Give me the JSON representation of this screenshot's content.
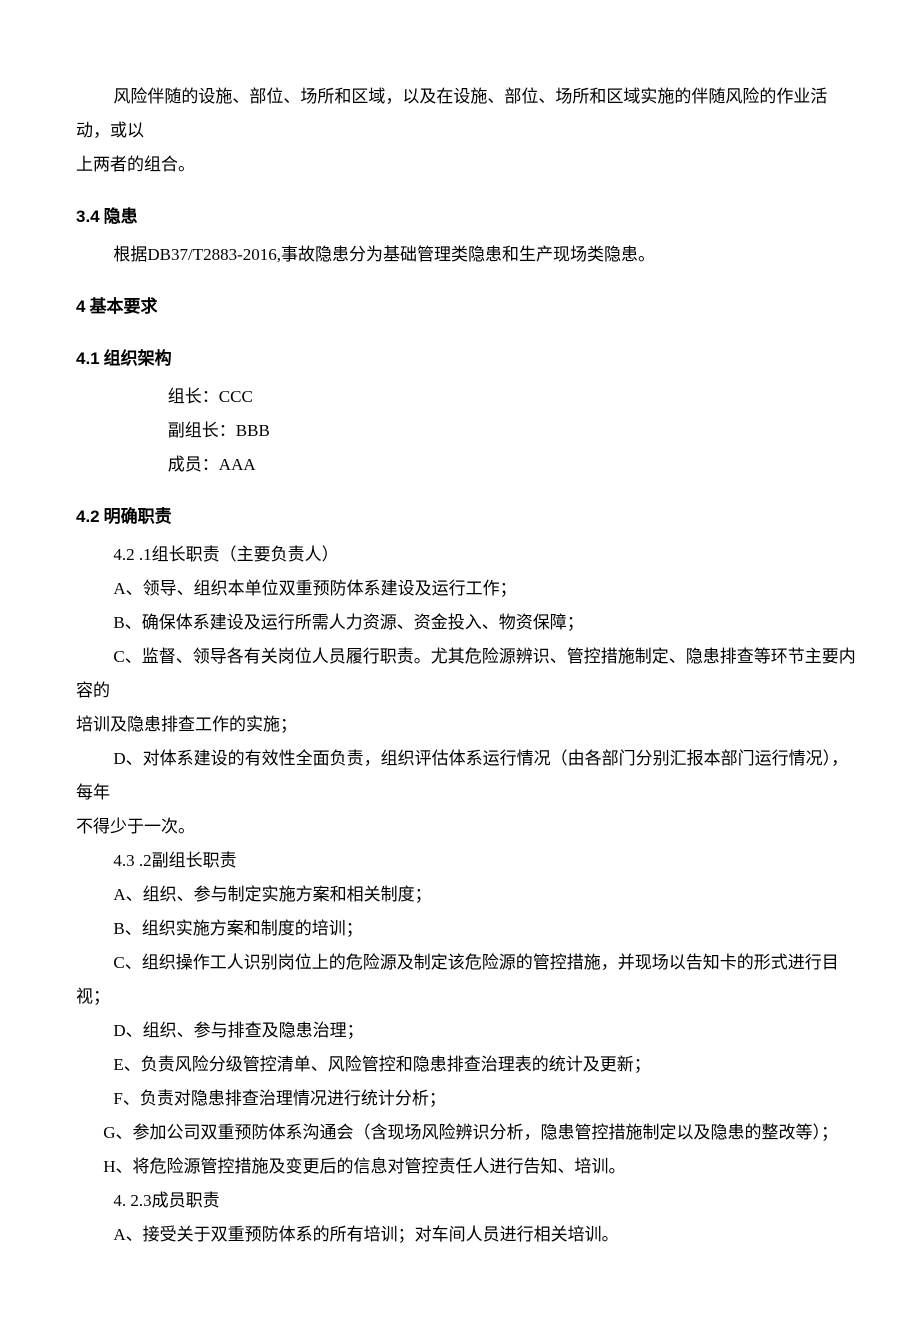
{
  "p1_a": "风险伴随的设施、部位、场所和区域，以及在设施、部位、场所和区域实施的伴随风险的作业活动，或以",
  "p1_b": "上两者的组合。",
  "h34_num": "3.4",
  "h34_txt": "隐患",
  "p2": "根据DB37/T2883-2016,事故隐患分为基础管理类隐患和生产现场类隐患。",
  "h4_num": "4",
  "h4_txt": "基本要求",
  "h41_num": "4.1",
  "h41_txt": "组织架构",
  "org1": "组长：CCC",
  "org2": "副组长：BBB",
  "org3": "成员：AAA",
  "h42_num": "4.2",
  "h42_txt": "明确职责",
  "s421": "4.2 .1组长职责（主要负责人）",
  "s421a": "A、领导、组织本单位双重预防体系建设及运行工作；",
  "s421b": "B、确保体系建设及运行所需人力资源、资金投入、物资保障；",
  "s421c_a": "C、监督、领导各有关岗位人员履行职责。尤其危险源辨识、管控措施制定、隐患排查等环节主要内容的",
  "s421c_b": "培训及隐患排查工作的实施；",
  "s421d_a": "D、对体系建设的有效性全面负责，组织评估体系运行情况（由各部门分别汇报本部门运行情况），每年",
  "s421d_b": "不得少于一次。",
  "s422": "4.3 .2副组长职责",
  "s422a": "A、组织、参与制定实施方案和相关制度；",
  "s422b": "B、组织实施方案和制度的培训；",
  "s422c": "C、组织操作工人识别岗位上的危险源及制定该危险源的管控措施，并现场以告知卡的形式进行目视；",
  "s422d": "D、组织、参与排查及隐患治理；",
  "s422e": "E、负责风险分级管控清单、风险管控和隐患排查治理表的统计及更新；",
  "s422f": "F、负责对隐患排查治理情况进行统计分析；",
  "s422g": "G、参加公司双重预防体系沟通会（含现场风险辨识分析，隐患管控措施制定以及隐患的整改等）；",
  "s422h": "H、将危险源管控措施及变更后的信息对管控责任人进行告知、培训。",
  "s423": "4. 2.3成员职责",
  "s423a": "A、接受关于双重预防体系的所有培训；对车间人员进行相关培训。"
}
